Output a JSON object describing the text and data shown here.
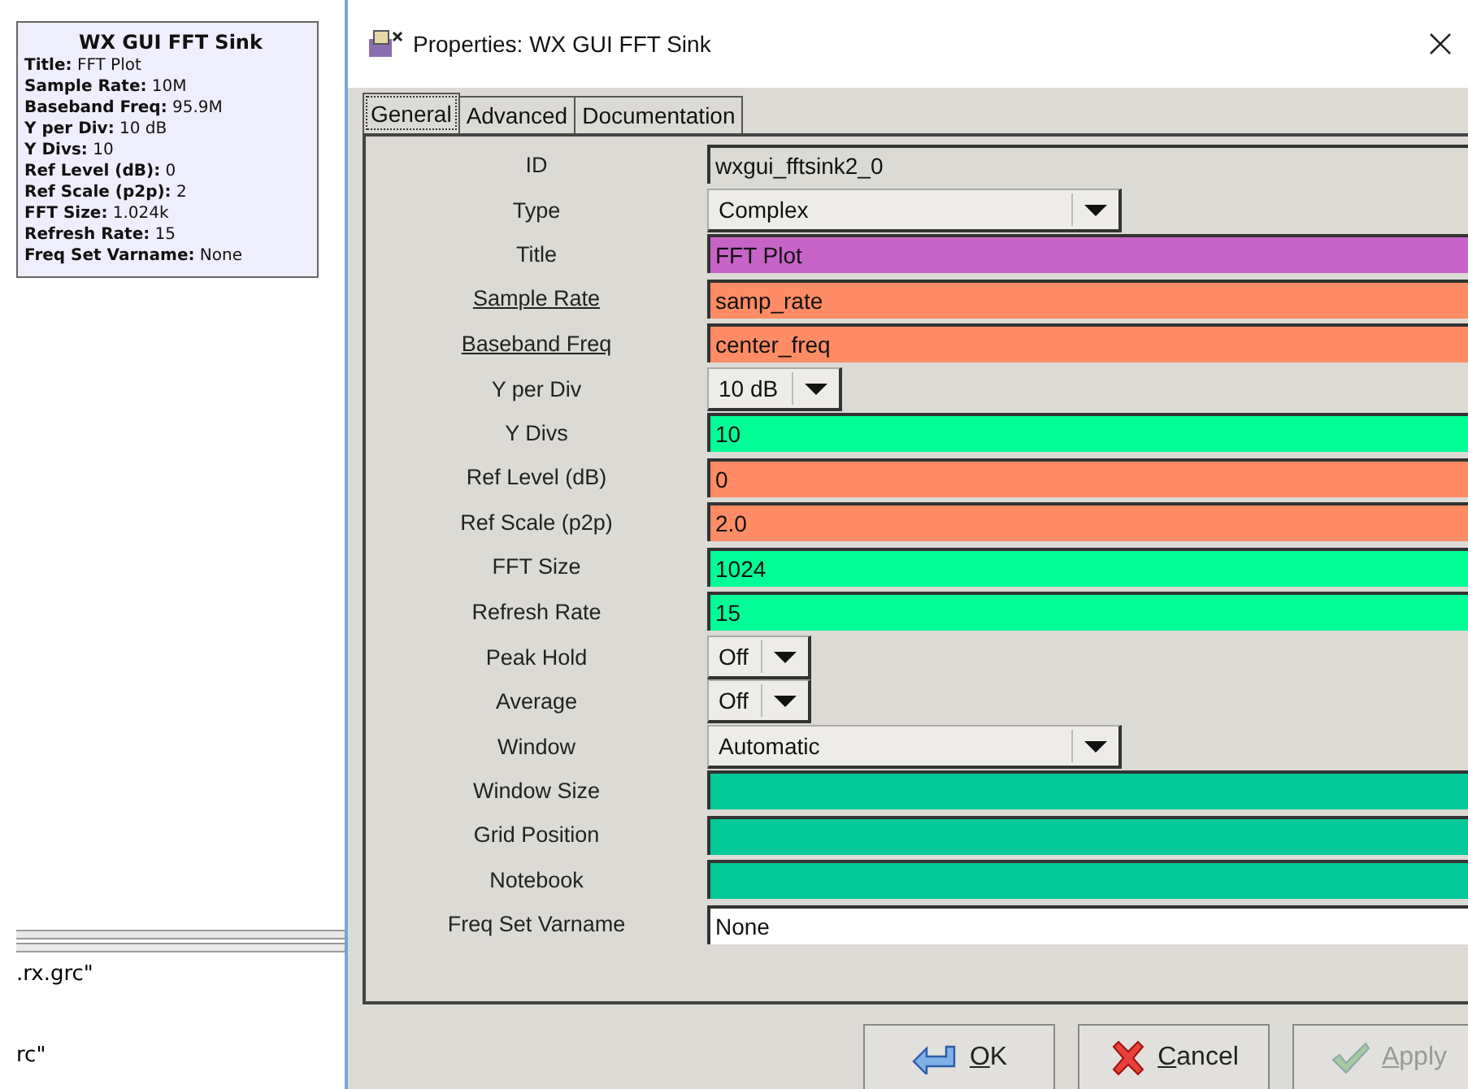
{
  "block": {
    "title": "WX GUI FFT Sink",
    "params": [
      {
        "name": "Title:",
        "value": "FFT Plot"
      },
      {
        "name": "Sample Rate:",
        "value": "10M"
      },
      {
        "name": "Baseband Freq:",
        "value": "95.9M"
      },
      {
        "name": "Y per Div:",
        "value": "10 dB"
      },
      {
        "name": "Y Divs:",
        "value": "10"
      },
      {
        "name": "Ref Level (dB):",
        "value": "0"
      },
      {
        "name": "Ref Scale (p2p):",
        "value": "2"
      },
      {
        "name": "FFT Size:",
        "value": "1.024k"
      },
      {
        "name": "Refresh Rate:",
        "value": "15"
      },
      {
        "name": "Freq Set Varname:",
        "value": "None"
      }
    ]
  },
  "console_lines": [
    ".rx.grc\"",
    "rc\""
  ],
  "dialog": {
    "title": "Properties: WX GUI FFT Sink",
    "tabs": [
      {
        "label": "General",
        "selected": true
      },
      {
        "label": "Advanced",
        "selected": false
      },
      {
        "label": "Documentation",
        "selected": false
      }
    ],
    "params": [
      {
        "label": "ID",
        "kind": "text",
        "value": "wxgui_fftsink2_0",
        "color": "#dcdad5",
        "underlined": false
      },
      {
        "label": "Type",
        "kind": "dropdown",
        "value": "Complex",
        "underlined": false
      },
      {
        "label": "Title",
        "kind": "text",
        "value": "FFT Plot",
        "color": "#c864c8",
        "underlined": false
      },
      {
        "label": "Sample Rate",
        "kind": "text",
        "value": "samp_rate",
        "color": "#ff8c64",
        "underlined": true
      },
      {
        "label": "Baseband Freq",
        "kind": "text",
        "value": "center_freq",
        "color": "#ff8c64",
        "underlined": true
      },
      {
        "label": "Y per Div",
        "kind": "dropdown",
        "value": "10 dB",
        "underlined": false
      },
      {
        "label": "Y Divs",
        "kind": "text",
        "value": "10",
        "color": "#00ff96",
        "underlined": false
      },
      {
        "label": "Ref Level (dB)",
        "kind": "text",
        "value": "0",
        "color": "#ff8c64",
        "underlined": false
      },
      {
        "label": "Ref Scale (p2p)",
        "kind": "text",
        "value": "2.0",
        "color": "#ff8c64",
        "underlined": false
      },
      {
        "label": "FFT Size",
        "kind": "text",
        "value": "1024",
        "color": "#00ff96",
        "underlined": false
      },
      {
        "label": "Refresh Rate",
        "kind": "text",
        "value": "15",
        "color": "#00ff96",
        "underlined": false
      },
      {
        "label": "Peak Hold",
        "kind": "dropdown",
        "value": "Off",
        "underlined": false
      },
      {
        "label": "Average",
        "kind": "dropdown",
        "value": "Off",
        "underlined": false
      },
      {
        "label": "Window",
        "kind": "dropdown",
        "value": "Automatic",
        "underlined": false
      },
      {
        "label": "Window Size",
        "kind": "text",
        "color": "#00c896",
        "underlined": false
      },
      {
        "label": "Grid Position",
        "kind": "text",
        "color": "#00c896",
        "underlined": false
      },
      {
        "label": "Notebook",
        "kind": "text",
        "color": "#00c896",
        "underlined": false
      },
      {
        "label": "Freq Set Varname",
        "kind": "text",
        "value": "None",
        "color": "#ffffff",
        "underlined": false
      }
    ],
    "buttons": [
      {
        "label": "OK",
        "kind": "ok",
        "disabled": false
      },
      {
        "label": "Cancel",
        "kind": "cancel",
        "disabled": false
      },
      {
        "label": "Apply",
        "kind": "apply",
        "disabled": true
      }
    ]
  }
}
